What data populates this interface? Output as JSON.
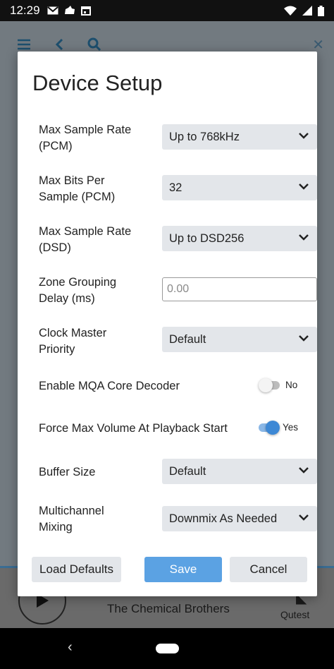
{
  "status_bar": {
    "time": "12:29",
    "left_icons": [
      "gmail-icon",
      "cloud-icon",
      "calendar-icon"
    ],
    "right_icons": [
      "wifi-icon",
      "signal-icon",
      "battery-icon"
    ]
  },
  "background_app": {
    "toolbar_icons": [
      "menu-icon",
      "back-arrow-icon",
      "search-icon",
      "close-icon"
    ],
    "now_playing": {
      "artist": "The Chemical Brothers",
      "zone": "Qutest"
    }
  },
  "dialog": {
    "title": "Device Setup",
    "settings": [
      {
        "label": "Max Sample Rate (PCM)",
        "type": "select",
        "value": "Up to 768kHz"
      },
      {
        "label": "Max Bits Per Sample (PCM)",
        "type": "select",
        "value": "32"
      },
      {
        "label": "Max Sample Rate (DSD)",
        "type": "select",
        "value": "Up to DSD256"
      },
      {
        "label": "Zone Grouping Delay (ms)",
        "type": "input",
        "value": "",
        "placeholder": "0.00"
      },
      {
        "label": "Clock Master Priority",
        "type": "select",
        "value": "Default"
      },
      {
        "label": "Enable MQA Core Decoder",
        "type": "toggle",
        "state": "No"
      },
      {
        "label": "Force Max Volume At Playback Start",
        "type": "toggle",
        "state": "Yes"
      },
      {
        "label": "Buffer Size",
        "type": "select",
        "value": "Default"
      },
      {
        "label": "Multichannel Mixing",
        "type": "select",
        "value": "Downmix As Needed"
      }
    ],
    "buttons": {
      "load_defaults": "Load Defaults",
      "save": "Save",
      "cancel": "Cancel"
    }
  },
  "colors": {
    "accent": "#5ba2e3",
    "toggle_on": "#3d88d5",
    "select_bg": "#e3e6ea"
  }
}
